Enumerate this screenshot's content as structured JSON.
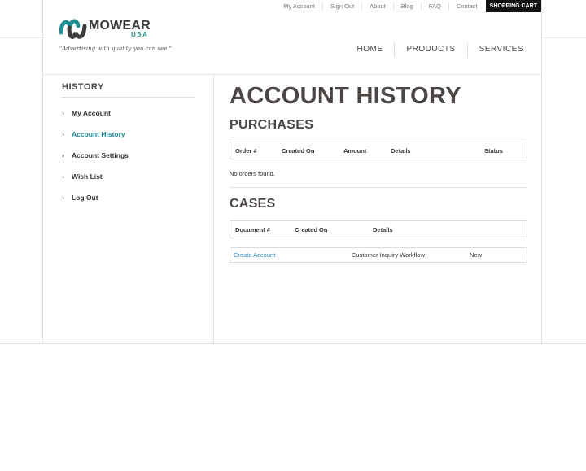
{
  "utility_nav": {
    "items": [
      "My Account",
      "Sign Out",
      "About",
      "Blog",
      "FAQ",
      "Contact"
    ],
    "cart_label": "SHOPPING CART"
  },
  "logo": {
    "name": "MOWEAR",
    "sub": "USA",
    "tagline": "\"Advertising with quality you can see.\""
  },
  "main_nav": {
    "items": [
      "HOME",
      "PRODUCTS",
      "SERVICES"
    ]
  },
  "sidebar": {
    "title": "HISTORY",
    "items": [
      {
        "label": "My Account",
        "active": false
      },
      {
        "label": "Account History",
        "active": true
      },
      {
        "label": "Account Settings",
        "active": false
      },
      {
        "label": "Wish List",
        "active": false
      },
      {
        "label": "Log Out",
        "active": false
      }
    ]
  },
  "main": {
    "title": "ACCOUNT HISTORY",
    "purchases": {
      "title": "PURCHASES",
      "columns": [
        "Order #",
        "Created On",
        "Amount",
        "Details",
        "Status"
      ],
      "empty_text": "No orders found."
    },
    "cases": {
      "title": "CASES",
      "columns": [
        "Document #",
        "Created On",
        "Details"
      ],
      "rows": [
        {
          "document": "Create Account",
          "details": "Customer Inquiry Workflow",
          "status": "New"
        }
      ]
    }
  },
  "colors": {
    "accent": "#1e8a94",
    "link": "#2a8ac2",
    "heading": "#4b4644"
  }
}
